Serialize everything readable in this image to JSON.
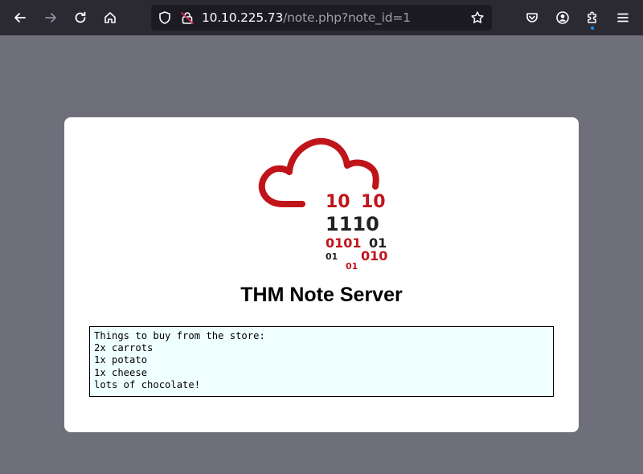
{
  "browser": {
    "url_host": "10.10.225.73",
    "url_path": "/note.php?note_id=1"
  },
  "logo": {
    "digits": [
      "10",
      "10",
      "1110",
      "0101",
      "01",
      "01",
      "010",
      "01"
    ],
    "colors": {
      "red": "#c0141b",
      "dark": "#222222"
    }
  },
  "page": {
    "title": "THM Note Server",
    "note": "Things to buy from the store:\n2x carrots\n1x potato\n1x cheese\nlots of chocolate!"
  }
}
